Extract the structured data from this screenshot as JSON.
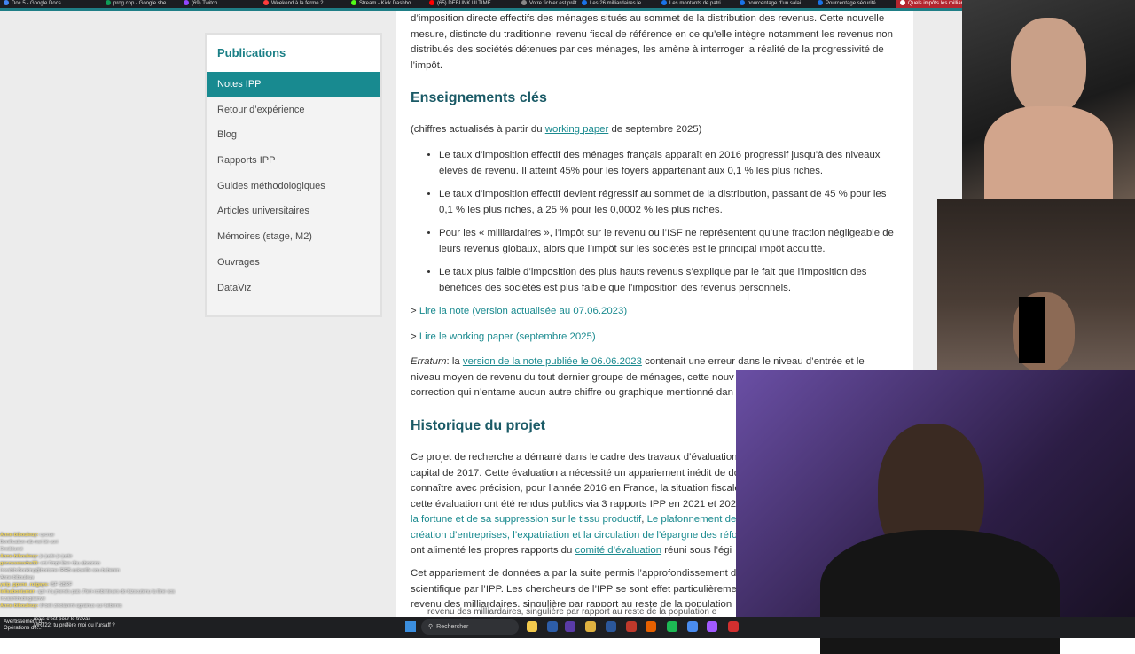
{
  "browser": {
    "tabs": [
      {
        "label": "Doc 5 - Google Docs",
        "color": "#4285f4"
      },
      {
        "label": "prog cop - Google she",
        "color": "#0f9d58"
      },
      {
        "label": "(69) Twitch",
        "color": "#9146ff"
      },
      {
        "label": "Weekend à la ferme 2",
        "color": "#ff3b3b"
      },
      {
        "label": "Stream - Kick Dashbo",
        "color": "#53fc18"
      },
      {
        "label": "(65) DEBUNK ULTIME",
        "color": "#ff0000"
      },
      {
        "label": "Votre fichier est prêt",
        "color": "#888888"
      },
      {
        "label": "Les 26 milliardaires le",
        "color": "#1a73e8"
      },
      {
        "label": "Les montants de patri",
        "color": "#1a73e8"
      },
      {
        "label": "pourcentage d'un salai",
        "color": "#1a73e8"
      },
      {
        "label": "Pourcentage sécurité",
        "color": "#1a73e8"
      },
      {
        "label": "Quels impôts les milliar",
        "color": "#ffffff"
      }
    ],
    "accent": "#1f7e86"
  },
  "sidebar": {
    "title": "Publications",
    "items": [
      {
        "label": "Notes IPP",
        "active": true
      },
      {
        "label": "Retour d’expérience"
      },
      {
        "label": "Blog"
      },
      {
        "label": "Rapports IPP"
      },
      {
        "label": "Guides méthodologiques"
      },
      {
        "label": "Articles universitaires"
      },
      {
        "label": "Mémoires (stage, M2)"
      },
      {
        "label": "Ouvrages"
      },
      {
        "label": "DataViz"
      }
    ]
  },
  "article": {
    "intro": [
      "d’imposition directe effectifs des ménages situés au sommet de la distribution des revenus. Cette nouvelle",
      "mesure, distincte du traditionnel revenu fiscal de référence en ce qu’elle intègre notamment les revenus non",
      "distribués des sociétés détenues par ces ménages, les amène à interroger la réalité de la progressivité de",
      "l’impôt."
    ],
    "section1_title": "Enseignements clés",
    "actualise_pre": "(chiffres actualisés à partir du ",
    "actualise_link": "working paper",
    "actualise_post": " de septembre 2025)",
    "bullets": [
      "Le taux d’imposition effectif des ménages français apparaît en 2016 progressif jusqu’à des niveaux élevés de revenu. Il atteint 45% pour les foyers appartenant aux 0,1 % les plus riches.",
      "Le taux d’imposition effectif devient régressif au sommet de la distribution, passant de 45 % pour les 0,1 % les plus riches, à 25 % pour les 0,0002 % les plus riches.",
      "Pour les « milliardaires », l’impôt sur le revenu ou l’ISF ne représentent qu’une fraction négligeable de leurs revenus globaux, alors que l’impôt sur les sociétés est le principal impôt acquitté.",
      "Le taux plus faible d’imposition des plus hauts revenus s’explique par le fait que l’imposition des bénéfices des sociétés est plus faible que l’imposition des revenus personnels."
    ],
    "link1_prefix": "> ",
    "link1": "Lire la note (version actualisée au 07.06.2023)",
    "link2_prefix": "> ",
    "link2": "Lire le working paper (septembre 2025)",
    "erratum_label": "Erratum",
    "erratum_sep": ": la ",
    "erratum_link": "version de la note publiée le 06.06.2023",
    "erratum_line1_rest": " contenait une erreur dans le niveau d’entrée et le",
    "erratum_line2": "niveau moyen de revenu du tout dernier groupe de ménages, cette nouv",
    "erratum_line3": "correction qui n’entame aucun autre chiffre ou graphique mentionné dan",
    "section2_title": "Historique du projet",
    "hist_line1": "Ce projet de recherche a démarré dans le cadre des travaux d’évaluation",
    "hist_line2": "capital de 2017. Cette évaluation a nécessité un appariement inédit de do",
    "hist_line3": "connaître avec précision, pour l’année 2016 en France, la situation fiscale",
    "hist_line4": "cette évaluation ont été rendus publics via 3 rapports IPP en 2021 et 202",
    "hist_line5_link": "la fortune et de sa suppression sur le tissu productif",
    "hist_line5_sep": ", ",
    "hist_line5_link2": "Le plafonnement de",
    "hist_line6_link": "création d’entreprises, l’expatriation et la circulation de l’épargne des réfo",
    "hist_line7_pre": "ont alimenté les propres rapports du ",
    "hist_line7_link": "comité d’évaluation",
    "hist_line7_post": " réuni sous l’égi",
    "hist2_line1": "Cet appariement de données a par la suite permis l’approfondissement d",
    "hist2_line2": "scientifique par l’IPP. Les chercheurs de l’IPP se sont effet particulièremen",
    "hist2_line3": "revenu des milliardaires, singulière par rapport au reste de la population",
    "caption_overlay": "revenu des milliardaires, singulière par rapport au reste de la population e"
  },
  "chat": {
    "lines": [
      {
        "name": "Anne-bibouleuy:",
        "msg": "cycrue"
      },
      {
        "name": "",
        "msg": "Bonification nib mel tiè sori"
      },
      {
        "name": "",
        "msg": "Desibluest"
      },
      {
        "name": "Anne-bibouleuy:",
        "msg": "je juste je juste"
      },
      {
        "name": "gecosswuvhs33:",
        "msg": "ent l'impt libre ribu aboonno"
      },
      {
        "name": "",
        "msg": "Irorabib:Bonking@borisme IRRB aukseille sou buberen"
      },
      {
        "name": "",
        "msg": "Anne-bibouleuy"
      },
      {
        "name": "yuip_ppsne_ruigays:",
        "msg": "ISF SBRF"
      },
      {
        "name": "leilsaboniumer:",
        "msg": "apé n'a jmenés pais J'teri-ronbinteues do bizscutenu la lline sos"
      },
      {
        "name": "",
        "msg": "Inzaishthubingliainve"
      },
      {
        "name": "Anne-bibouleuy:",
        "msg": "ilf bell zinolarent agrainus sur beberes"
      }
    ]
  },
  "taskbar": {
    "notif1": "Avertissement d...",
    "notif2": "Opérations de...",
    "notif3": "mais c'est pour le travail",
    "notif4": "MRJ22: tu préfère moi ou l'ursaff ?",
    "search_label": "Rechercher",
    "search_icon": "search-icon",
    "icons": [
      {
        "name": "file-explorer-icon",
        "color": "#f2c94c"
      },
      {
        "name": "photoshop-icon",
        "color": "#2d5da8"
      },
      {
        "name": "premiere-icon",
        "color": "#5a3ba7"
      },
      {
        "name": "folder-icon",
        "color": "#e0b240"
      },
      {
        "name": "word-icon",
        "color": "#2b579a"
      },
      {
        "name": "app-red-icon",
        "color": "#c0392b"
      },
      {
        "name": "firefox-icon",
        "color": "#e66000"
      },
      {
        "name": "spotify-icon",
        "color": "#1db954"
      },
      {
        "name": "chrome-icon",
        "color": "#4a8cf0"
      },
      {
        "name": "messenger-icon",
        "color": "#a259ff"
      },
      {
        "name": "record-icon",
        "color": "#d22f2f"
      }
    ]
  }
}
